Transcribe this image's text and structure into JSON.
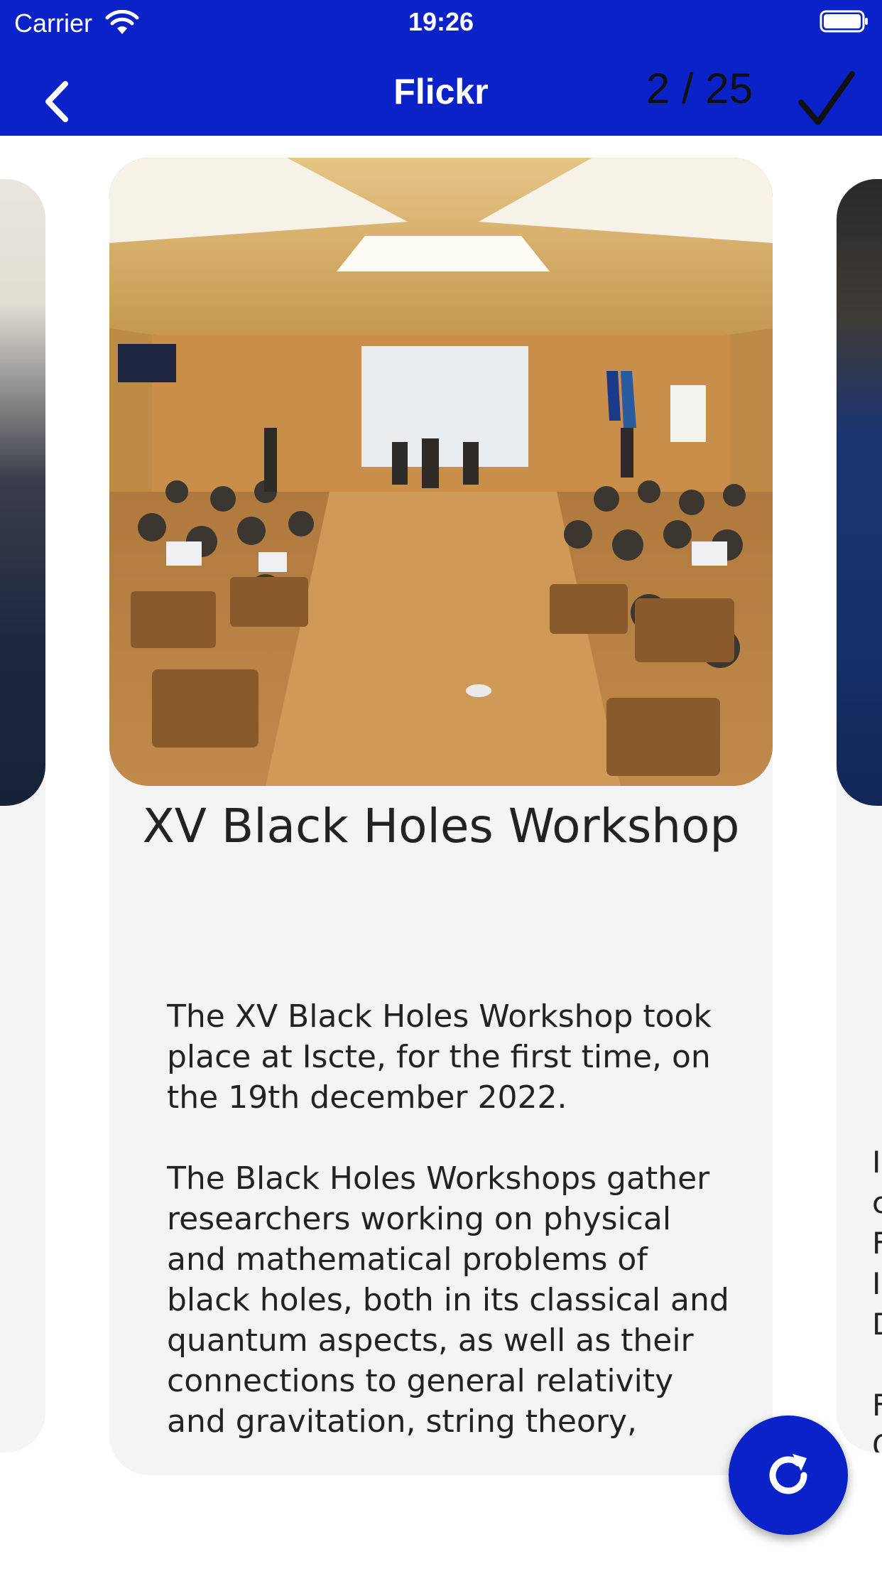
{
  "status_bar": {
    "carrier": "Carrier",
    "time": "19:26"
  },
  "nav": {
    "title": "Flickr",
    "counter": "2 / 25"
  },
  "card": {
    "title": "XV Black Holes Workshop",
    "description": "The XV Black Holes Workshop took place at Iscte, for the first time, on the 19th december 2022.\n\nThe Black Holes Workshops gather researchers working on physical and mathematical problems of black holes, both in its classical and quantum aspects, as well as their connections to general relativity and gravitation, string theory,"
  },
  "right_card_partial_text": "I\nc\nF\nI\nD\n\nF\nC",
  "colors": {
    "accent": "#0a22c8",
    "card_bg": "#f4f4f4"
  },
  "icons": [
    "wifi-icon",
    "battery-icon",
    "back-chevron-icon",
    "checkmark-icon",
    "refresh-icon"
  ]
}
